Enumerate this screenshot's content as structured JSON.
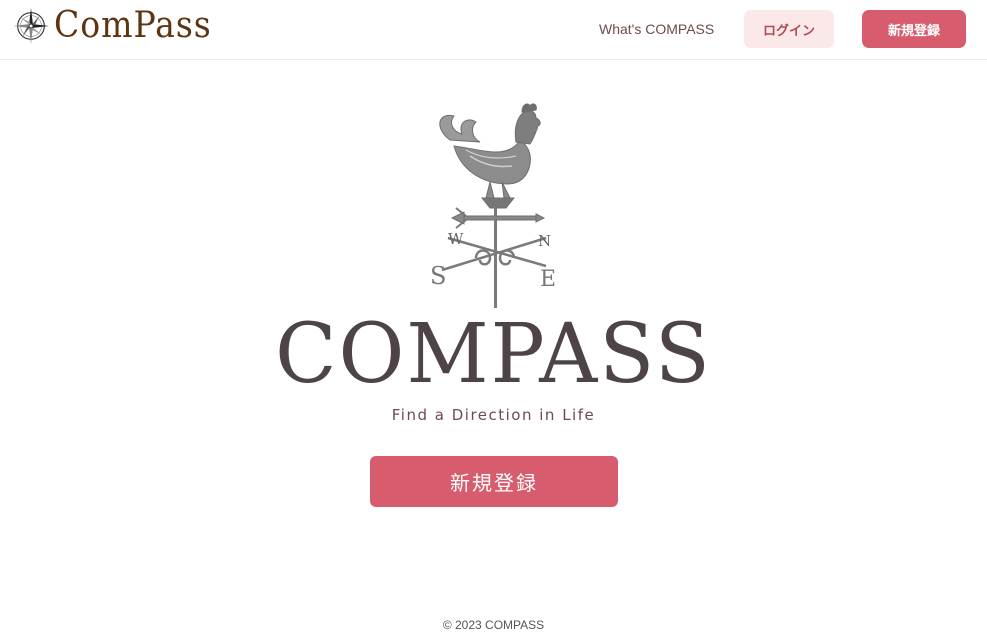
{
  "header": {
    "brand_name": "ComPass",
    "brand_icon": "compass-rose-icon",
    "nav_link": "What's COMPASS",
    "login_label": "ログイン",
    "register_label": "新規登録"
  },
  "hero": {
    "logo_icon": "weathervane-rooster-icon",
    "compass_letters": {
      "west": "W",
      "north": "N",
      "south": "S",
      "east": "E"
    },
    "title": "COMPASS",
    "tagline": "Find a Direction in Life",
    "register_label": "新規登録"
  },
  "footer": {
    "copyright": "© 2023 COMPASS"
  },
  "colors": {
    "accent": "#d75d6e",
    "login_bg": "#fbe8e8",
    "login_text": "#b04a5a",
    "brand_text": "#5e3512",
    "title_text": "#4e4446"
  }
}
